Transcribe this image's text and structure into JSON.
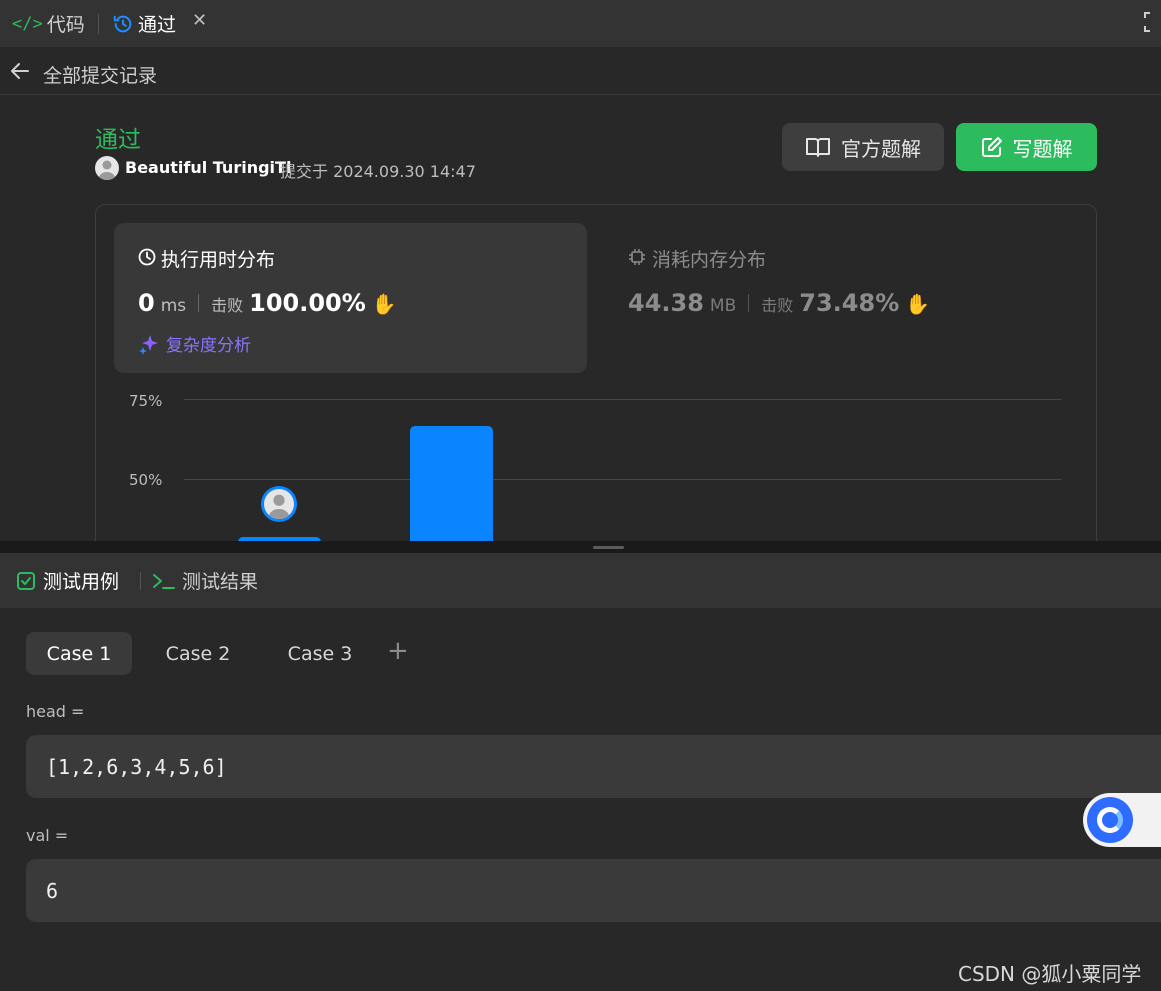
{
  "tabs": {
    "code_label": "代码",
    "result_label": "通过",
    "close_glyph": "✕"
  },
  "subbar": {
    "back_label": "全部提交记录"
  },
  "submission": {
    "status": "通过",
    "status_color": "#2cbb5d",
    "user": "Beautiful TuringiTl",
    "submitted_text": "提交于 2024.09.30 14:47"
  },
  "buttons": {
    "official_solution": "官方题解",
    "write_solution": "写题解"
  },
  "runtime": {
    "title": "执行用时分布",
    "value": "0",
    "unit": "ms",
    "beats_label": "击败",
    "beats_pct": "100.00%",
    "analysis_label": "复杂度分析"
  },
  "memory": {
    "title": "消耗内存分布",
    "value": "44.38",
    "unit": "MB",
    "beats_label": "击败",
    "beats_pct": "73.48%"
  },
  "chart_data": {
    "type": "bar",
    "y_ticks": [
      "75%",
      "50%"
    ],
    "grid": true
  },
  "bottom_tabs": {
    "testcase_label": "测试用例",
    "result_label": "测试结果"
  },
  "cases": [
    "Case 1",
    "Case 2",
    "Case 3"
  ],
  "add_case_glyph": "+",
  "inputs": {
    "head_label": "head =",
    "head_value": "[1,2,6,3,4,5,6]",
    "val_label": "val =",
    "val_value": "6"
  },
  "watermark": "CSDN @狐小粟同学",
  "colors": {
    "accent_blue": "#0a84ff",
    "accent_green": "#2cbb5d"
  }
}
